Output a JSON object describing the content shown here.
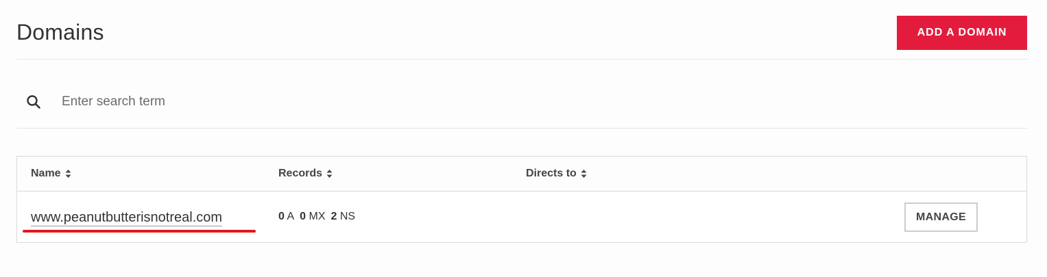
{
  "header": {
    "title": "Domains",
    "add_button": "ADD A DOMAIN"
  },
  "search": {
    "placeholder": "Enter search term",
    "value": ""
  },
  "table": {
    "columns": [
      "Name",
      "Records",
      "Directs to"
    ],
    "rows": [
      {
        "name": "www.peanutbutterisnotreal.com",
        "records": {
          "a_count": "0",
          "a_label": "A",
          "mx_count": "0",
          "mx_label": "MX",
          "ns_count": "2",
          "ns_label": "NS"
        },
        "directs_to": "",
        "action": "MANAGE"
      }
    ]
  },
  "colors": {
    "accent": "#e31c3d",
    "annotation_underline": "#e0181d"
  },
  "icons": {
    "search": "magnifier-icon",
    "sort": "sort-updown-icon"
  }
}
